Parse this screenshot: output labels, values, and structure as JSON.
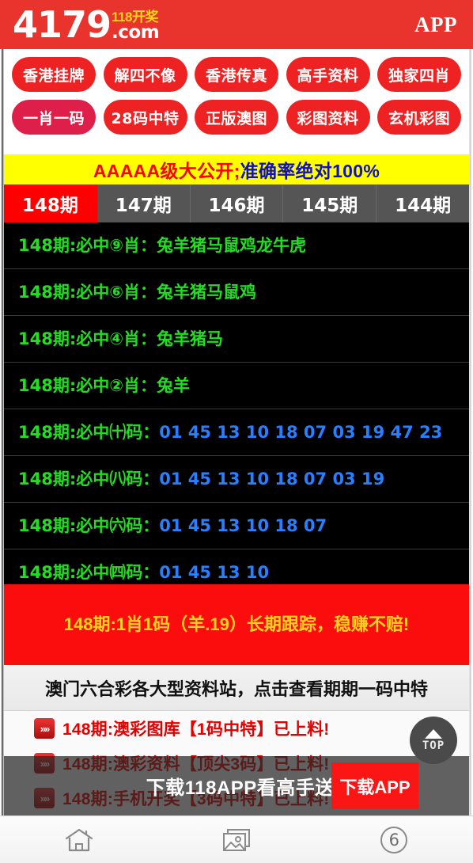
{
  "header": {
    "logo_number": "4179",
    "logo_sub": "118开奖",
    "logo_domain": ".com",
    "app_label": "APP"
  },
  "nav": {
    "row1": [
      {
        "label": "香港挂牌",
        "name": "nav-hk-guapai"
      },
      {
        "label": "解四不像",
        "name": "nav-jie-sibuxiang"
      },
      {
        "label": "香港传真",
        "name": "nav-hk-chuanzhen"
      },
      {
        "label": "高手资料",
        "name": "nav-gaoshou-ziliao"
      },
      {
        "label": "独家四肖",
        "name": "nav-dujia-sixiao"
      }
    ],
    "row2": [
      {
        "label": "一肖一码",
        "name": "nav-yixiao-yima"
      },
      {
        "label": "28码中特",
        "name": "nav-28ma-zhongte"
      },
      {
        "label": "正版澳图",
        "name": "nav-zhengban-aotu"
      },
      {
        "label": "彩图资料",
        "name": "nav-caitu-ziliao"
      },
      {
        "label": "玄机彩图",
        "name": "nav-xuanji-caitu"
      }
    ]
  },
  "banner": {
    "red_part": "AAAAA级大公开;",
    "blue_part": "准确率绝对100%"
  },
  "tabs": {
    "items": [
      {
        "label": "148期",
        "active": true
      },
      {
        "label": "147期",
        "active": false
      },
      {
        "label": "146期",
        "active": false
      },
      {
        "label": "145期",
        "active": false
      },
      {
        "label": "144期",
        "active": false
      }
    ]
  },
  "predictions": [
    {
      "label": "148期:必中⑨肖：",
      "value": "兔羊猪马鼠鸡龙牛虎",
      "value_color": "green"
    },
    {
      "label": "148期:必中⑥肖：",
      "value": "兔羊猪马鼠鸡",
      "value_color": "green"
    },
    {
      "label": "148期:必中④肖：",
      "value": "兔羊猪马",
      "value_color": "green"
    },
    {
      "label": "148期:必中②肖：",
      "value": "兔羊",
      "value_color": "green"
    },
    {
      "label": "148期:必中㈩码：",
      "value": "01 45 13 10 18 07 03 19 47 23",
      "value_color": "blue"
    },
    {
      "label": "148期:必中㈧码：",
      "value": "01 45 13 10 18 07 03 19",
      "value_color": "blue"
    },
    {
      "label": "148期:必中㈥码：",
      "value": "01 45 13 10 18 07",
      "value_color": "blue"
    },
    {
      "label": "148期:必中㈣码：",
      "value": "01 45 13 10",
      "value_color": "blue"
    }
  ],
  "promo": {
    "text": "148期:1肖1码（羊.19）长期跟踪，稳赚不赔!"
  },
  "subhead": {
    "text": "澳门六合彩各大型资料站，点击查看期期一码中特"
  },
  "link_rows": [
    {
      "chevron": "»»",
      "text": "148期:澳彩图库【1码中特】已上料!"
    },
    {
      "chevron": "»»",
      "text": "148期:澳彩资料【顶尖3码】已上料!"
    },
    {
      "chevron": "»»",
      "text": "148期:手机开奖【3码中特】已上料!"
    }
  ],
  "top_button": {
    "label": "TOP"
  },
  "app_overlay": {
    "text": "下载118APP看高手送特",
    "button_label": "下载APP"
  },
  "bottom_nav": [
    {
      "icon": "home-icon",
      "badge": ""
    },
    {
      "icon": "gallery-icon",
      "badge": ""
    },
    {
      "icon": "count-badge-icon",
      "badge": "6"
    }
  ],
  "colors": {
    "brand_red": "#e8342c",
    "pill_red": "#ee2222",
    "pill_alt": "#dd1f4a",
    "banner_yellow": "#ffff00",
    "banner_red_text": "#ff0000",
    "banner_blue_text": "#1010c0",
    "tab_active": "#ff0000",
    "tab_inactive": "#555555",
    "list_bg": "#000000",
    "list_green": "#22dd22",
    "list_blue": "#2a7fff",
    "promo_bg": "#fc0d0d",
    "promo_text": "#ffd21e",
    "link_red": "#e30000"
  }
}
